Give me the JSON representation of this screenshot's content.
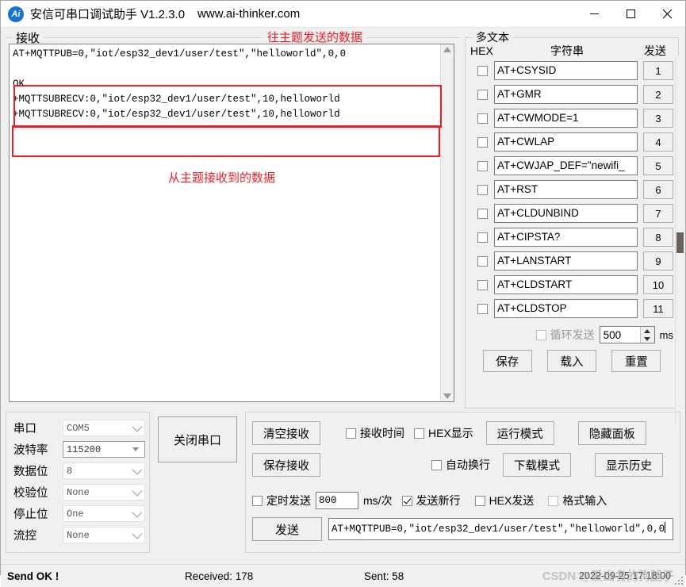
{
  "window": {
    "title": "安信可串口调试助手 V1.2.3.0",
    "url": "www.ai-thinker.com",
    "icon": "Ai",
    "minimize": "—",
    "maximize": "□",
    "close": "✕"
  },
  "receive": {
    "group_label": "接收",
    "annotation_top": "往主题发送的数据",
    "annotation_bottom": "从主题接收到的数据",
    "text": "AT+MQTTPUB=0,\"iot/esp32_dev1/user/test\",\"helloworld\",0,0\n\nOK\n+MQTTSUBRECV:0,\"iot/esp32_dev1/user/test\",10,helloworld\n+MQTTSUBRECV:0,\"iot/esp32_dev1/user/test\",10,helloworld"
  },
  "multitext": {
    "group_label": "多文本",
    "col_hex": "HEX",
    "col_string": "字符串",
    "col_send": "发送",
    "rows": [
      {
        "cmd": "AT+CSYSID",
        "btn": "1",
        "hex": false
      },
      {
        "cmd": "AT+GMR",
        "btn": "2",
        "hex": false
      },
      {
        "cmd": "AT+CWMODE=1",
        "btn": "3",
        "hex": false
      },
      {
        "cmd": "AT+CWLAP",
        "btn": "4",
        "hex": false
      },
      {
        "cmd": "AT+CWJAP_DEF=\"newifi_",
        "btn": "5",
        "hex": false
      },
      {
        "cmd": "AT+RST",
        "btn": "6",
        "hex": false
      },
      {
        "cmd": "AT+CLDUNBIND",
        "btn": "7",
        "hex": false
      },
      {
        "cmd": "AT+CIPSTA?",
        "btn": "8",
        "hex": false
      },
      {
        "cmd": "AT+LANSTART",
        "btn": "9",
        "hex": false
      },
      {
        "cmd": "AT+CLDSTART",
        "btn": "10",
        "hex": false
      },
      {
        "cmd": "AT+CLDSTOP",
        "btn": "11",
        "hex": false
      }
    ],
    "loop_send_label": "循环发送",
    "loop_interval": "500",
    "loop_unit": "ms",
    "save_btn": "保存",
    "load_btn": "载入",
    "reset_btn": "重置"
  },
  "serial": {
    "rows": [
      {
        "label": "串口",
        "value": "COM5"
      },
      {
        "label": "波特率",
        "value": "115200"
      },
      {
        "label": "数据位",
        "value": "8"
      },
      {
        "label": "校验位",
        "value": "None"
      },
      {
        "label": "停止位",
        "value": "One"
      },
      {
        "label": "流控",
        "value": "None"
      }
    ],
    "close_port_btn": "关闭串口"
  },
  "controls": {
    "clear_recv_btn": "清空接收",
    "save_recv_btn": "保存接收",
    "recv_time_label": "接收时间",
    "hex_display_label": "HEX显示",
    "auto_newline_label": "自动换行",
    "run_mode_btn": "运行模式",
    "download_mode_btn": "下载模式",
    "hide_panel_btn": "隐藏面板",
    "show_history_btn": "显示历史",
    "timed_send_label": "定时发送",
    "timed_send_value": "800",
    "ms_per_time_label": "ms/次",
    "send_newline_label": "发送新行",
    "hex_send_label": "HEX发送",
    "format_input_label": "格式输入",
    "send_btn": "发送",
    "send_input_value": "AT+MQTTPUB=0,\"iot/esp32_dev1/user/test\",\"helloworld\",0,0"
  },
  "status": {
    "send_status": "Send OK !",
    "received": "Received: 178",
    "sent": "Sent: 58",
    "timestamp": "2022-09-25 17:18:00",
    "watermark": "CSDN @爱出名的狗腿子"
  }
}
